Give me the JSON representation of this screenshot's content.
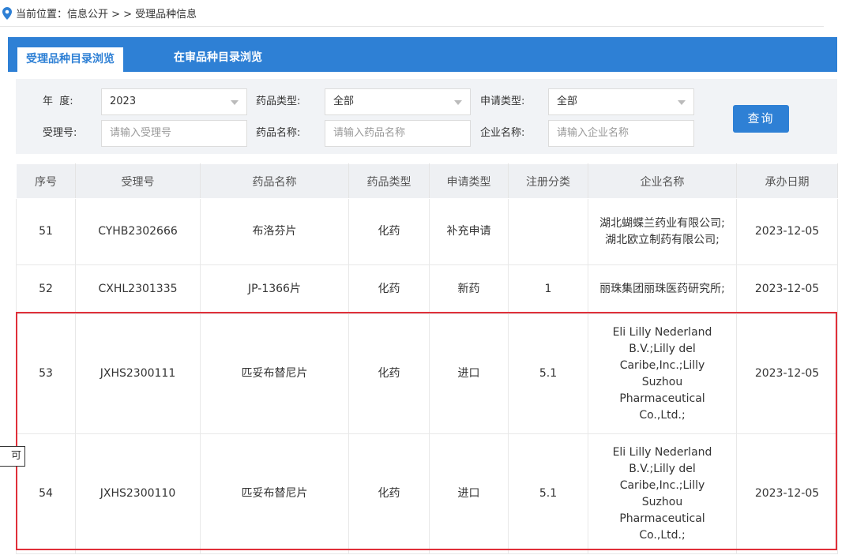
{
  "breadcrumb": {
    "icon": "location-pin-icon",
    "text": "当前位置：信息公开 > > 受理品种信息"
  },
  "tabs": [
    {
      "label": "受理品种目录浏览",
      "active": true
    },
    {
      "label": "在审品种目录浏览",
      "active": false
    }
  ],
  "search": {
    "year_label": "年  度:",
    "year_value": "2023",
    "drug_type_label": "药品类型:",
    "drug_type_value": "全部",
    "apply_type_label": "申请类型:",
    "apply_type_value": "全部",
    "accept_no_label": "受理号:",
    "accept_no_placeholder": "请输入受理号",
    "drug_name_label": "药品名称:",
    "drug_name_placeholder": "请输入药品名称",
    "company_label": "企业名称:",
    "company_placeholder": "请输入企业名称",
    "query_button": "查询"
  },
  "table": {
    "headers": [
      "序号",
      "受理号",
      "药品名称",
      "药品类型",
      "申请类型",
      "注册分类",
      "企业名称",
      "承办日期"
    ],
    "rows": [
      {
        "no": "51",
        "accept_no": "CYHB2302666",
        "drug": "布洛芬片",
        "type": "化药",
        "apply": "补充申请",
        "cls": "",
        "company": "湖北蝴蝶兰药业有限公司;湖北欧立制药有限公司;",
        "date": "2023-12-05"
      },
      {
        "no": "52",
        "accept_no": "CXHL2301335",
        "drug": "JP-1366片",
        "type": "化药",
        "apply": "新药",
        "cls": "1",
        "company": "丽珠集团丽珠医药研究所;",
        "date": "2023-12-05"
      },
      {
        "no": "53",
        "accept_no": "JXHS2300111",
        "drug": "匹妥布替尼片",
        "type": "化药",
        "apply": "进口",
        "cls": "5.1",
        "company": "Eli Lilly Nederland B.V.;Lilly del Caribe,Inc.;Lilly Suzhou Pharmaceutical Co.,Ltd.;",
        "date": "2023-12-05"
      },
      {
        "no": "54",
        "accept_no": "JXHS2300110",
        "drug": "匹妥布替尼片",
        "type": "化药",
        "apply": "进口",
        "cls": "5.1",
        "company": "Eli Lilly Nederland B.V.;Lilly del Caribe,Inc.;Lilly Suzhou Pharmaceutical Co.,Ltd.;",
        "date": "2023-12-05"
      }
    ]
  },
  "tooltip": "可",
  "colors": {
    "accent": "#2e80d5",
    "highlight": "#e0303a"
  }
}
